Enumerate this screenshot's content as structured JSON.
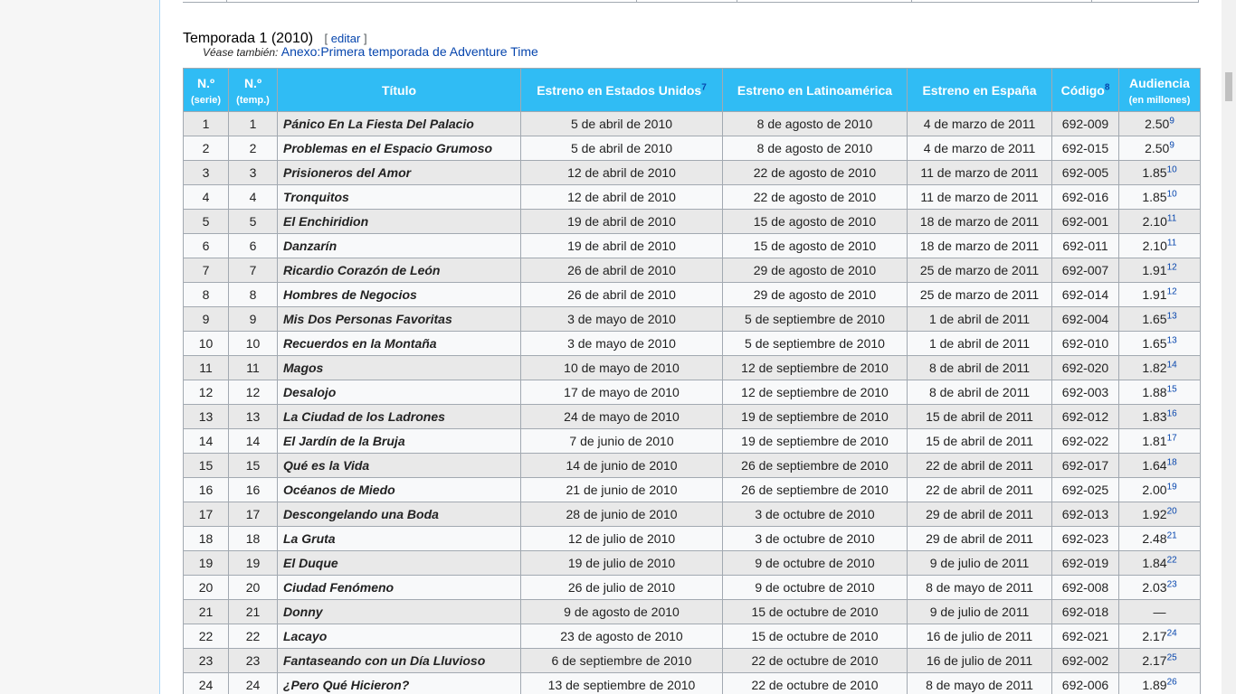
{
  "heading": {
    "title": "Temporada 1 (2010)",
    "edit_open": "[",
    "edit_label": "editar",
    "edit_close": "]"
  },
  "see_also": {
    "prefix": "Véase también:",
    "link": "Anexo:Primera temporada de Adventure Time"
  },
  "table": {
    "headers": {
      "num_serie": "N.º",
      "num_serie_sub": "(serie)",
      "num_temp": "N.º",
      "num_temp_sub": "(temp.)",
      "title": "Título",
      "us": "Estreno en Estados Unidos",
      "us_ref": "7",
      "latam": "Estreno en Latinoamérica",
      "spain": "Estreno en España",
      "code": "Código",
      "code_ref": "8",
      "audience": "Audiencia",
      "audience_sub": "(en millones)"
    },
    "rows": [
      {
        "n": "1",
        "t": "1",
        "title": "Pánico En La Fiesta Del Palacio",
        "us": "5 de abril de 2010",
        "latam": "8 de agosto de 2010",
        "es": "4 de marzo de 2011",
        "code": "692-009",
        "aud": "2.50",
        "ref": "9"
      },
      {
        "n": "2",
        "t": "2",
        "title": "Problemas en el Espacio Grumoso",
        "us": "5 de abril de 2010",
        "latam": "8 de agosto de 2010",
        "es": "4 de marzo de 2011",
        "code": "692-015",
        "aud": "2.50",
        "ref": "9"
      },
      {
        "n": "3",
        "t": "3",
        "title": "Prisioneros del Amor",
        "us": "12 de abril de 2010",
        "latam": "22 de agosto de 2010",
        "es": "11 de marzo de 2011",
        "code": "692-005",
        "aud": "1.85",
        "ref": "10"
      },
      {
        "n": "4",
        "t": "4",
        "title": "Tronquitos",
        "us": "12 de abril de 2010",
        "latam": "22 de agosto de 2010",
        "es": "11 de marzo de 2011",
        "code": "692-016",
        "aud": "1.85",
        "ref": "10"
      },
      {
        "n": "5",
        "t": "5",
        "title": "El Enchiridion",
        "us": "19 de abril de 2010",
        "latam": "15 de agosto de 2010",
        "es": "18 de marzo de 2011",
        "code": "692-001",
        "aud": "2.10",
        "ref": "11"
      },
      {
        "n": "6",
        "t": "6",
        "title": "Danzarín",
        "us": "19 de abril de 2010",
        "latam": "15 de agosto de 2010",
        "es": "18 de marzo de 2011",
        "code": "692-011",
        "aud": "2.10",
        "ref": "11"
      },
      {
        "n": "7",
        "t": "7",
        "title": "Ricardio Corazón de León",
        "us": "26 de abril de 2010",
        "latam": "29 de agosto de 2010",
        "es": "25 de marzo de 2011",
        "code": "692-007",
        "aud": "1.91",
        "ref": "12"
      },
      {
        "n": "8",
        "t": "8",
        "title": "Hombres de Negocios",
        "us": "26 de abril de 2010",
        "latam": "29 de agosto de 2010",
        "es": "25 de marzo de 2011",
        "code": "692-014",
        "aud": "1.91",
        "ref": "12"
      },
      {
        "n": "9",
        "t": "9",
        "title": "Mis Dos Personas Favoritas",
        "us": "3 de mayo de 2010",
        "latam": "5 de septiembre de 2010",
        "es": "1 de abril de 2011",
        "code": "692-004",
        "aud": "1.65",
        "ref": "13"
      },
      {
        "n": "10",
        "t": "10",
        "title": "Recuerdos en la Montaña",
        "us": "3 de mayo de 2010",
        "latam": "5 de septiembre de 2010",
        "es": "1 de abril de 2011",
        "code": "692-010",
        "aud": "1.65",
        "ref": "13"
      },
      {
        "n": "11",
        "t": "11",
        "title": "Magos",
        "us": "10 de mayo de 2010",
        "latam": "12 de septiembre de 2010",
        "es": "8 de abril de 2011",
        "code": "692-020",
        "aud": "1.82",
        "ref": "14"
      },
      {
        "n": "12",
        "t": "12",
        "title": "Desalojo",
        "us": "17 de mayo de 2010",
        "latam": "12 de septiembre de 2010",
        "es": "8 de abril de 2011",
        "code": "692-003",
        "aud": "1.88",
        "ref": "15"
      },
      {
        "n": "13",
        "t": "13",
        "title": "La Ciudad de los Ladrones",
        "us": "24 de mayo de 2010",
        "latam": "19 de septiembre de 2010",
        "es": "15 de abril de 2011",
        "code": "692-012",
        "aud": "1.83",
        "ref": "16"
      },
      {
        "n": "14",
        "t": "14",
        "title": "El Jardín de la Bruja",
        "us": "7 de junio de 2010",
        "latam": "19 de septiembre de 2010",
        "es": "15 de abril de 2011",
        "code": "692-022",
        "aud": "1.81",
        "ref": "17"
      },
      {
        "n": "15",
        "t": "15",
        "title": "Qué es la Vida",
        "us": "14 de junio de 2010",
        "latam": "26 de septiembre de 2010",
        "es": "22 de abril de 2011",
        "code": "692-017",
        "aud": "1.64",
        "ref": "18"
      },
      {
        "n": "16",
        "t": "16",
        "title": "Océanos de Miedo",
        "us": "21 de junio de 2010",
        "latam": "26 de septiembre de 2010",
        "es": "22 de abril de 2011",
        "code": "692-025",
        "aud": "2.00",
        "ref": "19"
      },
      {
        "n": "17",
        "t": "17",
        "title": "Descongelando una Boda",
        "us": "28 de junio de 2010",
        "latam": "3 de octubre de 2010",
        "es": "29 de abril de 2011",
        "code": "692-013",
        "aud": "1.92",
        "ref": "20"
      },
      {
        "n": "18",
        "t": "18",
        "title": "La Gruta",
        "us": "12 de julio de 2010",
        "latam": "3 de octubre de 2010",
        "es": "29 de abril de 2011",
        "code": "692-023",
        "aud": "2.48",
        "ref": "21"
      },
      {
        "n": "19",
        "t": "19",
        "title": "El Duque",
        "us": "19 de julio de 2010",
        "latam": "9 de octubre de 2010",
        "es": "9 de julio de 2011",
        "code": "692-019",
        "aud": "1.84",
        "ref": "22"
      },
      {
        "n": "20",
        "t": "20",
        "title": "Ciudad Fenómeno",
        "us": "26 de julio de 2010",
        "latam": "9 de octubre de 2010",
        "es": "8 de mayo de 2011",
        "code": "692-008",
        "aud": "2.03",
        "ref": "23"
      },
      {
        "n": "21",
        "t": "21",
        "title": "Donny",
        "us": "9 de agosto de 2010",
        "latam": "15 de octubre de 2010",
        "es": "9 de julio de 2011",
        "code": "692-018",
        "aud": "—",
        "ref": ""
      },
      {
        "n": "22",
        "t": "22",
        "title": "Lacayo",
        "us": "23 de agosto de 2010",
        "latam": "15 de octubre de 2010",
        "es": "16 de julio de 2011",
        "code": "692-021",
        "aud": "2.17",
        "ref": "24"
      },
      {
        "n": "23",
        "t": "23",
        "title": "Fantaseando con un Día Lluvioso",
        "us": "6 de septiembre de 2010",
        "latam": "22 de octubre de 2010",
        "es": "16 de julio de 2011",
        "code": "692-002",
        "aud": "2.17",
        "ref": "25"
      },
      {
        "n": "24",
        "t": "24",
        "title": "¿Pero Qué Hicieron?",
        "us": "13 de septiembre de 2010",
        "latam": "22 de octubre de 2010",
        "es": "8 de mayo de 2011",
        "code": "692-006",
        "aud": "1.89",
        "ref": "26"
      }
    ]
  }
}
